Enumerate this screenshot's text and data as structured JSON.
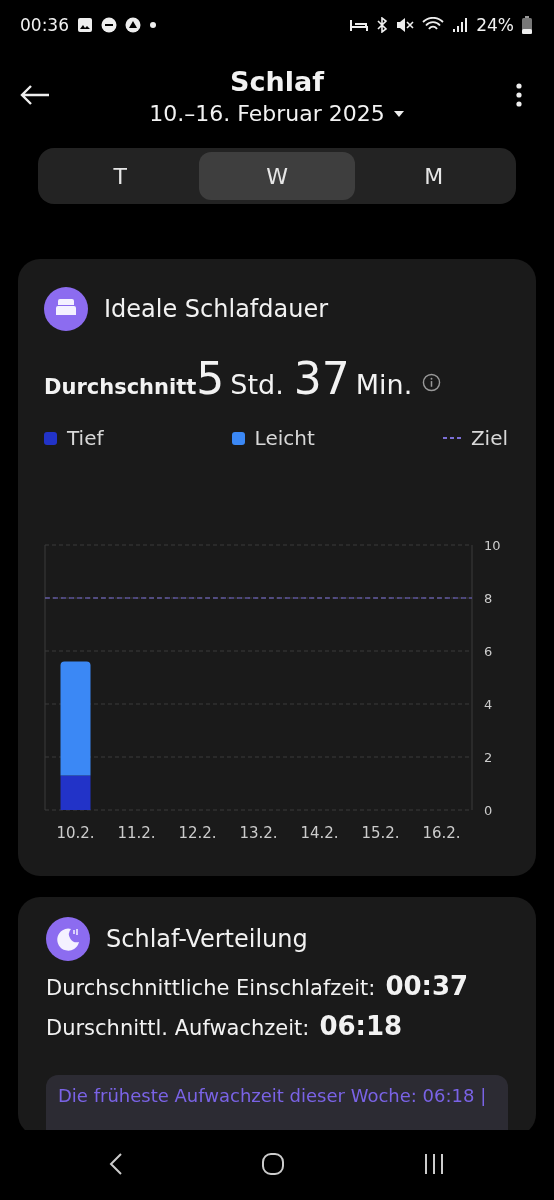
{
  "status_bar": {
    "time": "00:36",
    "battery": "24%"
  },
  "header": {
    "title": "Schlaf",
    "date_range": "10.–16. Februar 2025"
  },
  "tabs": [
    {
      "label": "T",
      "selected": false
    },
    {
      "label": "W",
      "selected": true
    },
    {
      "label": "M",
      "selected": false
    }
  ],
  "duration_card": {
    "title": "Ideale Schlafdauer",
    "average": {
      "label": "Durchschnitt",
      "hours": "5",
      "hours_unit": "Std.",
      "minutes": "37",
      "minutes_unit": "Min."
    },
    "chart_data": {
      "type": "bar",
      "stacked": true,
      "categories": [
        "10.2.",
        "11.2.",
        "12.2.",
        "13.2.",
        "14.2.",
        "15.2.",
        "16.2."
      ],
      "series": [
        {
          "name": "Tief",
          "color": "#2233c8",
          "values": [
            1.3,
            null,
            null,
            null,
            null,
            null,
            null
          ]
        },
        {
          "name": "Leicht",
          "color": "#3b88f5",
          "values": [
            4.3,
            null,
            null,
            null,
            null,
            null,
            null
          ]
        }
      ],
      "ylim": [
        0,
        10
      ],
      "yticks": [
        0,
        2,
        4,
        6,
        8,
        10
      ],
      "grid": true,
      "ref_lines": [
        {
          "axis": "y",
          "value": 8,
          "label": "Ziel",
          "color": "#7b6fd6"
        }
      ]
    }
  },
  "distribution_card": {
    "title": "Schlaf-Verteilung",
    "rows": [
      {
        "label": "Durchschnittliche Einschlafzeit:",
        "value": "00:37"
      },
      {
        "label": "Durschnittl. Aufwachzeit:",
        "value": "06:18"
      }
    ],
    "note": "Die früheste Aufwachzeit dieser Woche: 06:18 |"
  }
}
